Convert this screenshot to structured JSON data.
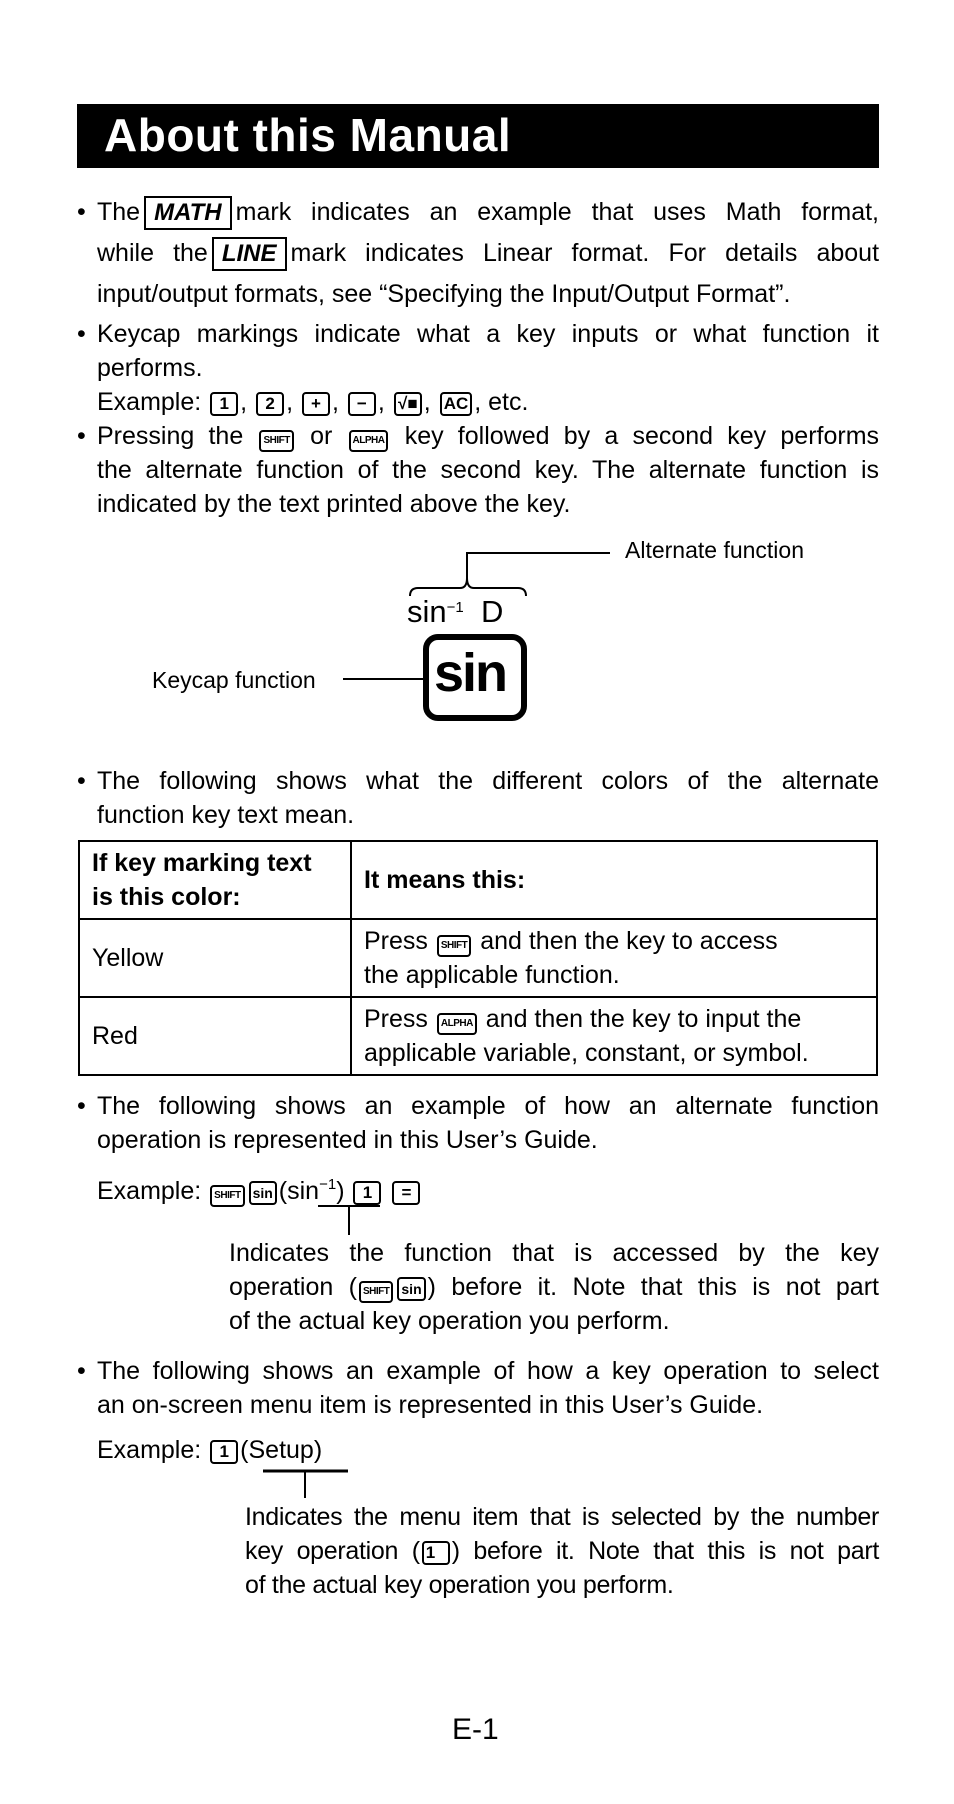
{
  "title": "About this Manual",
  "marks": {
    "math": "MATH",
    "line": "LINE"
  },
  "keys": {
    "one": "1",
    "two": "2",
    "plus": "+",
    "minus": "−",
    "sqrt": "√■",
    "ac": "AC",
    "shift": "SHIFT",
    "alpha": "ALPHA",
    "sin": "sin",
    "equals": "="
  },
  "p1": {
    "a": "The",
    "b": "mark indicates an example that uses Math format,",
    "c": "while the",
    "d": "mark indicates Linear format. For details about",
    "e": "input/output formats, see “Specifying the Input/Output Format”."
  },
  "p2": {
    "l1": "Keycap markings indicate what a key inputs or what function it",
    "l2": "performs.",
    "example": "Example:",
    "sep": ",",
    "etc": ", etc."
  },
  "p3": {
    "a": "Pressing the",
    "b": "or",
    "c": "key followed by a second key performs",
    "l2": "the alternate function of the second key. The alternate function is",
    "l3": "indicated by the text printed above the key."
  },
  "diagram": {
    "alternate_label": "Alternate function",
    "keycap_label": "Keycap function",
    "alt_text": "sin",
    "alt_sup": "−1",
    "alt_d": "D",
    "key_text": "sin"
  },
  "p4": {
    "l1": "The following shows what the different colors of the alternate",
    "l2": "function key text mean."
  },
  "table": {
    "headers": [
      "If key marking text is this color:",
      "It means this:"
    ],
    "rows": [
      {
        "color": "Yellow",
        "pre": "Press",
        "key": "SHIFT",
        "post": "and then the key to access",
        "l2": "the applicable function."
      },
      {
        "color": "Red",
        "pre": "Press",
        "key": "ALPHA",
        "post": "and then the key to input the",
        "l2": "applicable variable, constant, or symbol."
      }
    ]
  },
  "p5": {
    "l1": "The following shows an example of how an alternate function",
    "l2": "operation is represented in this User’s Guide.",
    "example": "Example:",
    "fn": "(sin",
    "fn_sup": "−1",
    "fn_close": ")",
    "note1": "Indicates the function that is accessed by the key",
    "note2a": "operation (",
    "note2b": ") before it. Note that this is not part",
    "note3": "of the actual key operation you perform."
  },
  "p6": {
    "l1": "The following shows an example of how a key operation to select",
    "l2": "an on-screen menu item is represented in this User’s Guide.",
    "example": "Example:",
    "menu": "(Setup)",
    "note1": "Indicates the menu item that is selected by the number",
    "note2a": "key operation (",
    "note2b": ") before it. Note that this is not part",
    "note3": "of the actual key operation you perform."
  },
  "page_number": "E-1"
}
